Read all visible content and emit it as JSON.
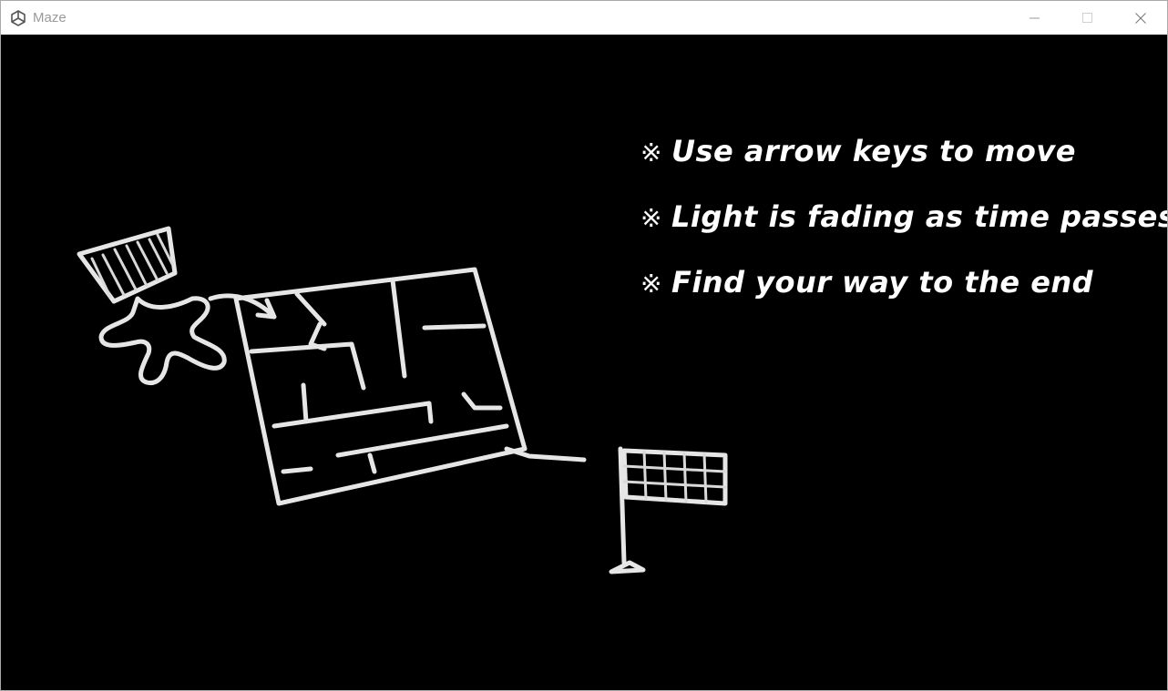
{
  "window": {
    "title": "Maze",
    "app_icon": "unity-icon",
    "controls": {
      "minimize_icon": "minimize-icon",
      "maximize_icon": "maximize-icon",
      "close_icon": "close-icon"
    }
  },
  "game": {
    "background_color": "#000000",
    "instructions": [
      {
        "bullet": "※",
        "text": "Use arrow keys to move"
      },
      {
        "bullet": "※",
        "text": "Light is fading as time passes"
      },
      {
        "bullet": "※",
        "text": "Find your way to the end"
      }
    ],
    "illustration": {
      "elements": [
        "player-figure",
        "maze-drawing",
        "goal-flag"
      ]
    }
  }
}
